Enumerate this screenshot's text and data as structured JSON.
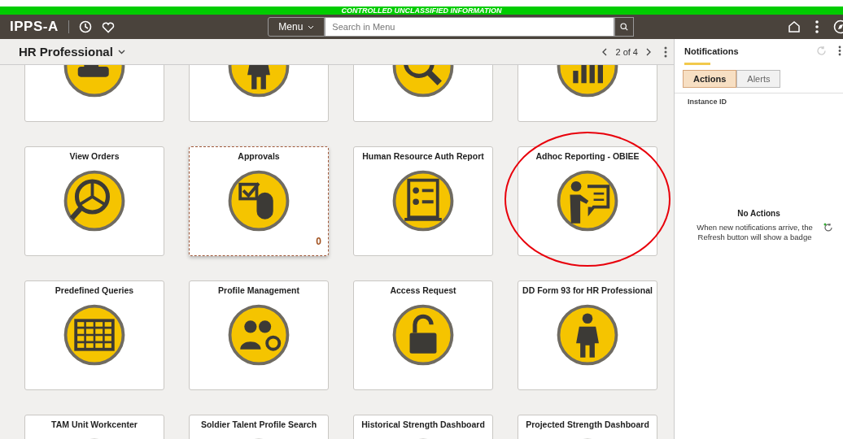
{
  "banner": {
    "text": "CONTROLLED UNCLASSIFIED INFORMATION"
  },
  "header": {
    "logo": "IPPS-A",
    "menu_button": "Menu",
    "search": {
      "placeholder": "Search in Menu"
    }
  },
  "page": {
    "title": "HR Professional",
    "pager": "2 of 4"
  },
  "tiles": [
    {
      "kind": "vehicle",
      "focused": false
    },
    {
      "kind": "soldier",
      "focused": false
    },
    {
      "kind": "magnifier",
      "focused": false
    },
    {
      "kind": "chart",
      "focused": false
    },
    {
      "title": "View Orders",
      "kind": "orders",
      "focused": false
    },
    {
      "title": "Approvals",
      "kind": "approvals",
      "focused": true,
      "count": "0"
    },
    {
      "title": "Human Resource Auth Report",
      "kind": "report",
      "focused": false
    },
    {
      "title": "Adhoc Reporting - OBIEE",
      "kind": "presenter",
      "focused": false,
      "highlighted": true
    },
    {
      "title": "Predefined Queries",
      "kind": "table",
      "focused": false
    },
    {
      "title": "Profile Management",
      "kind": "people",
      "focused": false
    },
    {
      "title": "Access Request",
      "kind": "padlock",
      "focused": false
    },
    {
      "title": "DD Form 93 for HR Professional",
      "kind": "soldier",
      "focused": false
    },
    {
      "title": "TAM Unit Workcenter",
      "kind": "none",
      "focused": false
    },
    {
      "title": "Soldier Talent Profile Search",
      "kind": "none",
      "focused": false
    },
    {
      "title": "Historical Strength Dashboard",
      "kind": "none",
      "focused": false
    },
    {
      "title": "Projected Strength Dashboard",
      "kind": "none",
      "focused": false
    }
  ],
  "notifications": {
    "title": "Notifications",
    "tabs": [
      {
        "label": "Actions",
        "selected": true
      },
      {
        "label": "Alerts",
        "selected": false
      }
    ],
    "column": "Instance ID",
    "empty_title": "No Actions",
    "empty_text": "When new notifications arrive, the Refresh button will show a badge"
  }
}
